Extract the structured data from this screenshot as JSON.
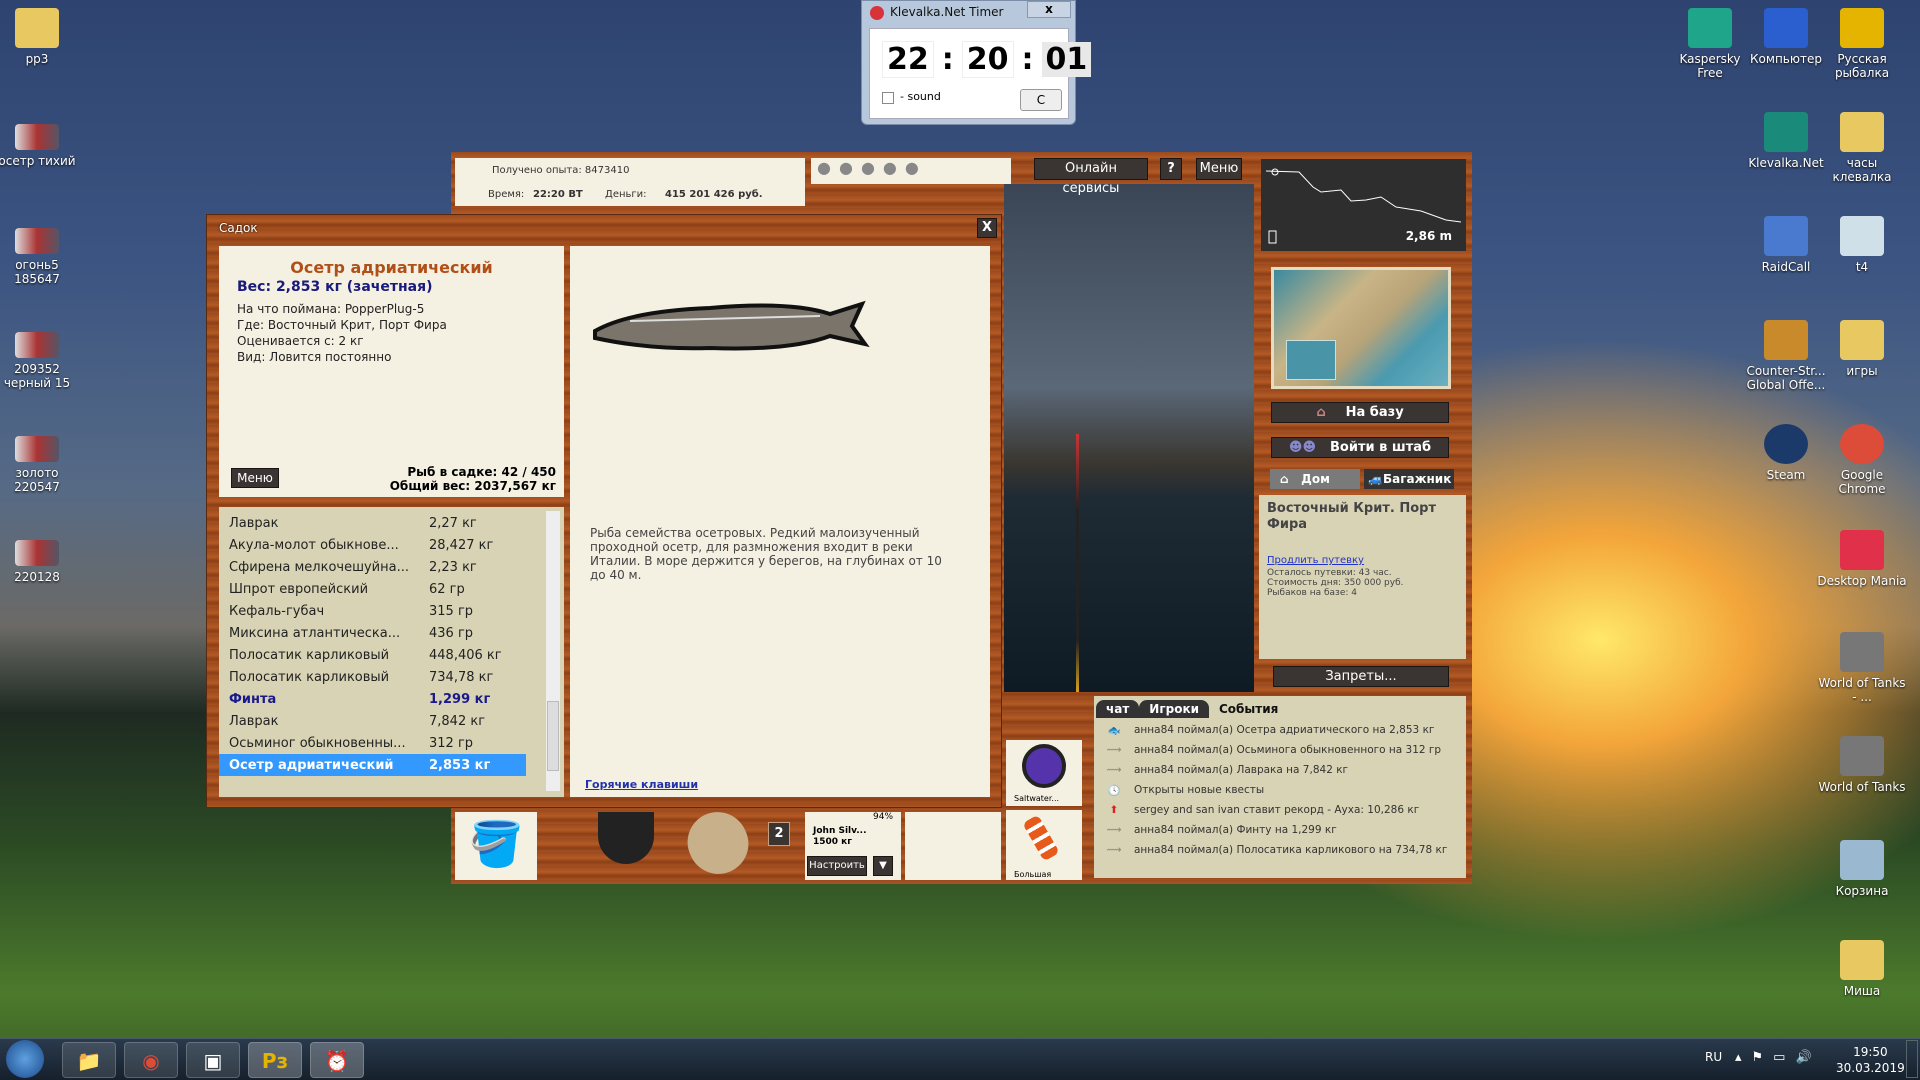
{
  "desktop_left": [
    {
      "label": "рр3",
      "icon": "folder-icon"
    },
    {
      "label": "осетр   тихий",
      "icon": "image-icon"
    },
    {
      "label": "огонь5 185647",
      "icon": "image-icon"
    },
    {
      "label": "209352 черный 15",
      "icon": "image-icon"
    },
    {
      "label": "золото 220547",
      "icon": "image-icon"
    },
    {
      "label": "220128",
      "icon": "image-icon"
    }
  ],
  "desktop_right": [
    {
      "label": "Kaspersky Free",
      "icon": "kaspersky-icon",
      "color": "#1fa58a"
    },
    {
      "label": "Компьютер",
      "icon": "computer-icon",
      "color": "#2b5fd0"
    },
    {
      "label": "Русская рыбалка",
      "icon": "rr3-icon",
      "color": "#e5b400"
    },
    {
      "label": "Klevalka.Net",
      "icon": "fish-icon",
      "color": "#1a8a7a"
    },
    {
      "label": "часы клевалка",
      "icon": "folder-icon",
      "color": "#e8c860"
    },
    {
      "label": "RaidCall",
      "icon": "raidcall-icon",
      "color": "#4a7ad0"
    },
    {
      "label": "t4",
      "icon": "window-icon",
      "color": "#cfe0e8"
    },
    {
      "label": "Counter-Str... Global Offe...",
      "icon": "csgo-icon",
      "color": "#c88a2a"
    },
    {
      "label": "игры",
      "icon": "folder-icon",
      "color": "#e8c860"
    },
    {
      "label": "Steam",
      "icon": "steam-icon",
      "color": "#1b3a6a"
    },
    {
      "label": "Google Chrome",
      "icon": "chrome-icon",
      "color": "#dd4b39"
    },
    {
      "label": "Desktop Mania",
      "icon": "dm-icon",
      "color": "#e0304a"
    },
    {
      "label": "World of Tanks - ...",
      "icon": "wot-icon",
      "color": "#777"
    },
    {
      "label": "World of Tanks",
      "icon": "wot-icon",
      "color": "#777"
    },
    {
      "label": "Корзина",
      "icon": "recycle-bin-icon",
      "color": "#9ab8d0"
    },
    {
      "label": "Миша",
      "icon": "folder-icon",
      "color": "#e8c860"
    }
  ],
  "timer": {
    "title": "Klevalka.Net Timer",
    "close": "x",
    "hours": "22",
    "minutes": "20",
    "seconds": "01",
    "sep": ":",
    "sound_label": "- sound",
    "sound_checked": false,
    "reset": "C"
  },
  "status": {
    "exp": "Получено опыта: 8473410",
    "time_label": "Время:",
    "time": "22:20 ВТ",
    "money_label": "Деньги:",
    "money": "415 201 426 руб."
  },
  "topmenu": {
    "online": "Онлайн сервисы",
    "help": "?",
    "menu": "Меню"
  },
  "sadok": {
    "title": "Садок",
    "close": "X",
    "fish_name": "Осетр адриатический",
    "weight": "Вес: 2,853 кг (зачетная)",
    "details": [
      "На что поймана: PopperPlug-5",
      "Где: Восточный Крит, Порт Фира",
      "Оценивается с: 2 кг",
      "Вид: Ловится постоянно"
    ],
    "menu": "Меню",
    "count": "Рыб в садке: 42 / 450",
    "total": "Общий вес: 2037,567 кг",
    "description": "Рыба семейства осетровых. Редкий малоизученный проходной осетр, для размножения входит в реки Италии. В море держится у берегов, на глубинах от 10 до 40 м.",
    "hotkeys": "Горячие клавиши",
    "list": [
      {
        "name": "Лаврак",
        "w": "2,27 кг"
      },
      {
        "name": "Акула-молот обыкнове...",
        "w": "28,427 кг"
      },
      {
        "name": "Сфирена мелкочешуйна...",
        "w": "2,23 кг"
      },
      {
        "name": "Шпрот европейский",
        "w": "62 гр"
      },
      {
        "name": "Кефаль-губач",
        "w": "315 гр"
      },
      {
        "name": "Миксина атлантическа...",
        "w": "436 гр"
      },
      {
        "name": "Полосатик карликовый",
        "w": "448,406 кг"
      },
      {
        "name": "Полосатик карликовый",
        "w": "734,78 кг"
      },
      {
        "name": "Финта",
        "w": "1,299 кг",
        "style": "bold"
      },
      {
        "name": "Лаврак",
        "w": "7,842 кг"
      },
      {
        "name": "Осьминог обыкновенны...",
        "w": "312 гр"
      },
      {
        "name": "Осетр адриатический",
        "w": "2,853 кг",
        "style": "sel"
      }
    ]
  },
  "right": {
    "depth": "2,86 m",
    "to_base": "На базу",
    "hq": "Войти в штаб",
    "tab_home": "Дом",
    "tab_trunk": "Багажник",
    "location": "Восточный Крит. Порт Фира",
    "extend": "Продлить путевку",
    "left": "Осталось путевки: 43 час.",
    "cost": "Стоимость дня: 350 000 руб.",
    "fishers": "Рыбаков на базе: 4",
    "bans": "Запреты..."
  },
  "bottom": {
    "slot_count": "2",
    "rod_pct": "94%",
    "rod_name": "John Silv...",
    "rod_cap": "1500 кг",
    "setup": "Настроить",
    "down": "▼",
    "lure1": "Saltwater...",
    "lure2": "Большая"
  },
  "events": {
    "tabs": [
      "чат",
      "Игроки",
      "События"
    ],
    "active_tab": "События",
    "items": [
      {
        "icon": "lure-icon",
        "text": "анна84 поймал(а) Осетра адриатического на 2,853 кг"
      },
      {
        "icon": "hook-icon",
        "text": "анна84 поймал(а) Осьминога обыкновенного на 312 гр"
      },
      {
        "icon": "hook-icon",
        "text": "анна84 поймал(а) Лавракa на 7,842 кг"
      },
      {
        "icon": "clock-icon",
        "text": "Открыты новые квесты"
      },
      {
        "icon": "record-arrow-icon",
        "text": "sergey and san ivan ставит рекорд - Ауха: 10,286 кг"
      },
      {
        "icon": "hook-icon",
        "text": "анна84 поймал(а) Финту на 1,299 кг"
      },
      {
        "icon": "hook-icon",
        "text": "анна84 поймал(а) Полосатика карликового на 734,78 кг"
      }
    ]
  },
  "taskbar": {
    "lang": "RU",
    "time": "19:50",
    "date": "30.03.2019",
    "rr3": "Рз"
  }
}
